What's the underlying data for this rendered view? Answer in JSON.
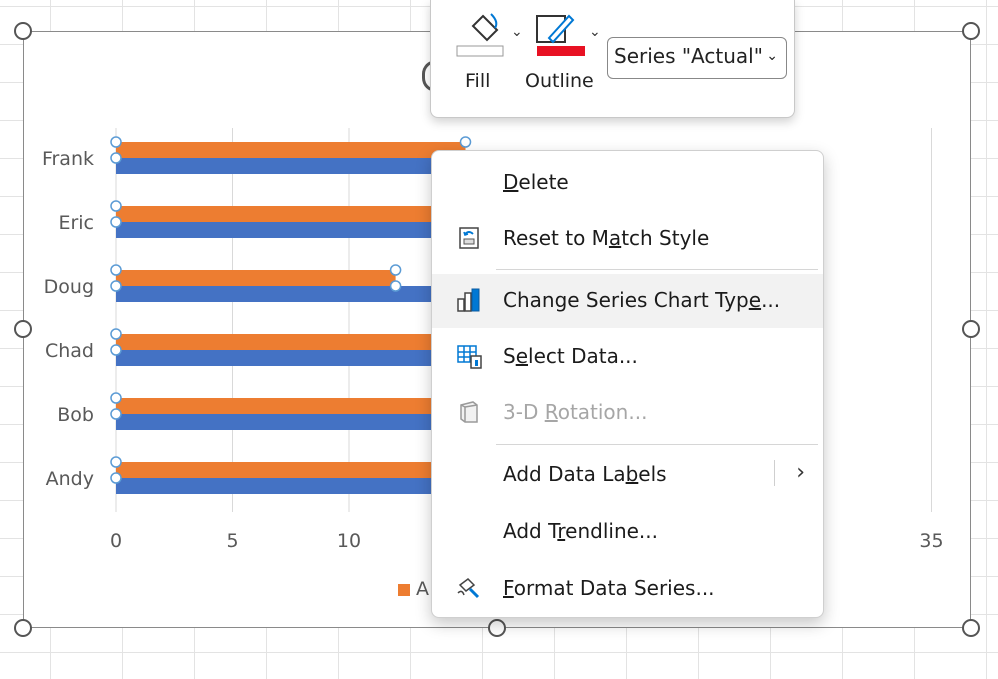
{
  "chart_data": {
    "type": "bar",
    "orientation": "horizontal",
    "categories": [
      "Andy",
      "Bob",
      "Chad",
      "Doug",
      "Eric",
      "Frank"
    ],
    "series": [
      {
        "name": "",
        "color": "#ED7D31",
        "values": [
          14,
          14,
          14,
          12,
          14,
          15
        ]
      },
      {
        "name": "",
        "color": "#4472C4",
        "values": [
          14,
          14,
          14,
          14,
          14,
          14
        ]
      }
    ],
    "x_ticks": [
      "0",
      "5",
      "10",
      "35"
    ],
    "xlim": [
      0,
      35
    ],
    "grid": true,
    "legend_position": "bottom",
    "legend_text": "A"
  },
  "ribbon": {
    "fill_label": "Fill",
    "outline_label": "Outline",
    "series_select_value": "Series \"Actual\""
  },
  "context_menu": {
    "items": [
      {
        "label": "Delete",
        "mnemonic_index": 0
      },
      {
        "label": "Reset to Match Style",
        "mnemonic_index": 10
      },
      {
        "label": "Change Series Chart Type...",
        "mnemonic_index": 23
      },
      {
        "label": "Select Data...",
        "mnemonic_index": 1
      },
      {
        "label": "3-D Rotation...",
        "mnemonic_index": 4,
        "disabled": true
      },
      {
        "label": "Add Data Labels",
        "mnemonic_index": 11,
        "submenu": true
      },
      {
        "label": "Add Trendline...",
        "mnemonic_index": 5
      },
      {
        "label": "Format Data Series...",
        "mnemonic_index": 0
      }
    ]
  },
  "colors": {
    "accent_orange": "#ED7D31",
    "accent_blue": "#4472C4",
    "outline_red": "#E81123"
  }
}
